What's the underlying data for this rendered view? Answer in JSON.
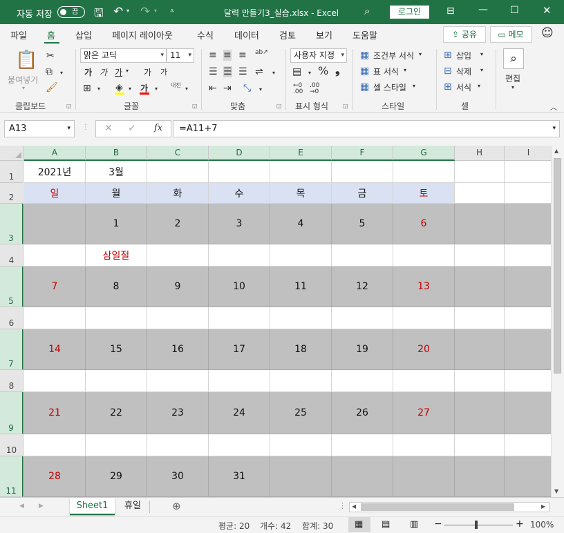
{
  "titlebar": {
    "autosave_label": "자동 저장",
    "toggle_text": "끔",
    "title": "달력 만들기3_실습.xlsx  -  Excel",
    "login_label": "로그인"
  },
  "menu": {
    "tabs": [
      "파일",
      "홈",
      "삽입",
      "페이지 레이아웃",
      "수식",
      "데이터",
      "검토",
      "보기",
      "도움말"
    ],
    "share_label": "공유",
    "memo_label": "메모"
  },
  "ribbon": {
    "clipboard": {
      "label": "클립보드",
      "paste_label": "붙여넣기"
    },
    "font": {
      "label": "글꼴",
      "font_name": "맑은 고딕",
      "font_size": "11",
      "bold": "가",
      "italic": "가",
      "underline": "가",
      "grow": "가",
      "shrink": "가",
      "phonetic": "내천",
      "font_color_glyph": "가"
    },
    "alignment": {
      "label": "맞춤"
    },
    "number": {
      "label": "표시 형식",
      "format": "사용자 지정"
    },
    "styles": {
      "label": "스타일",
      "conditional": "조건부 서식",
      "table": "표 서식",
      "cell": "셀 스타일"
    },
    "cells": {
      "label": "셀",
      "insert": "삽입",
      "delete": "삭제",
      "format": "서식"
    },
    "editing": {
      "label": "편집"
    },
    "font_color": "#ff0000",
    "fill_color": "#ffff00"
  },
  "formula_bar": {
    "name_box": "A13",
    "fx": "fx",
    "formula": "=A11+7"
  },
  "grid": {
    "columns": [
      "A",
      "B",
      "C",
      "D",
      "E",
      "F",
      "G",
      "H",
      "I"
    ],
    "rows": [
      "1",
      "2",
      "3",
      "4",
      "5",
      "6",
      "7",
      "8",
      "9",
      "10",
      "11"
    ],
    "cells": {
      "r1": [
        "2021년",
        "3월",
        "",
        "",
        "",
        "",
        "",
        "",
        ""
      ],
      "r2": [
        "일",
        "월",
        "화",
        "수",
        "목",
        "금",
        "토",
        "",
        ""
      ],
      "r3": [
        "",
        "1",
        "2",
        "3",
        "4",
        "5",
        "6",
        "",
        ""
      ],
      "r4": [
        "",
        "삼일절",
        "",
        "",
        "",
        "",
        "",
        "",
        ""
      ],
      "r5": [
        "7",
        "8",
        "9",
        "10",
        "11",
        "12",
        "13",
        "",
        ""
      ],
      "r6": [
        "",
        "",
        "",
        "",
        "",
        "",
        "",
        "",
        ""
      ],
      "r7": [
        "14",
        "15",
        "16",
        "17",
        "18",
        "19",
        "20",
        "",
        ""
      ],
      "r8": [
        "",
        "",
        "",
        "",
        "",
        "",
        "",
        "",
        ""
      ],
      "r9": [
        "21",
        "22",
        "23",
        "24",
        "25",
        "26",
        "27",
        "",
        ""
      ],
      "r10": [
        "",
        "",
        "",
        "",
        "",
        "",
        "",
        "",
        ""
      ],
      "r11": [
        "28",
        "29",
        "30",
        "31",
        "",
        "",
        "",
        "",
        ""
      ]
    },
    "colors": {
      "gray_fill": "#c0c0c0",
      "header_fill": "#d9e1f2",
      "red_text": "#c00000"
    }
  },
  "sheets": {
    "tabs": [
      "Sheet1",
      "휴일"
    ],
    "active": "Sheet1"
  },
  "status": {
    "average": "평균: 20",
    "count": "개수: 42",
    "sum": "합계: 30",
    "zoom": "100%"
  }
}
